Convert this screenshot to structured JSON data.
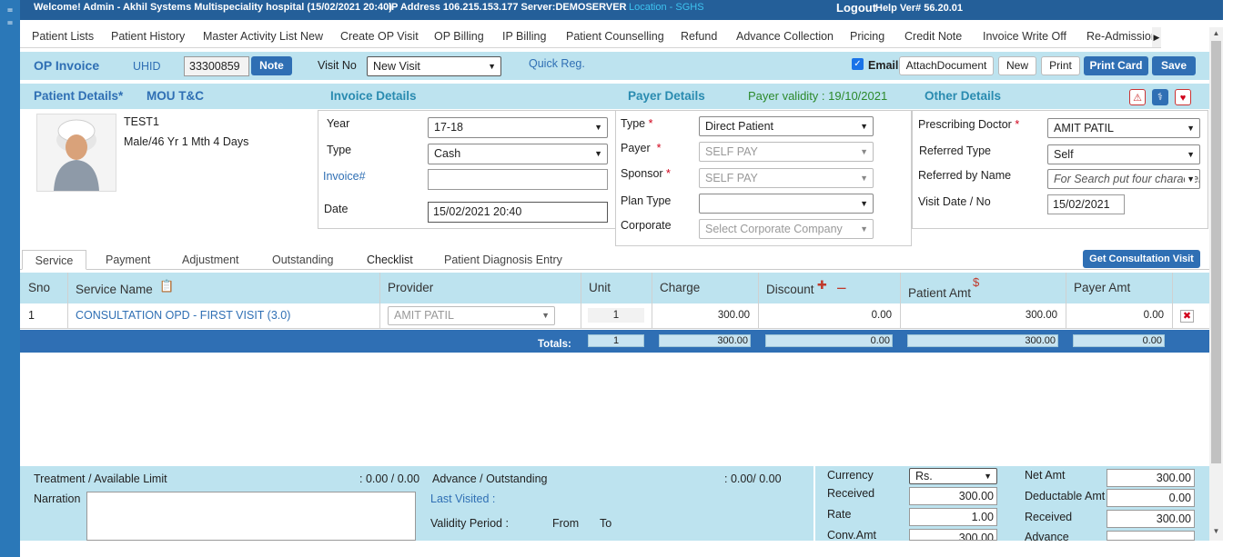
{
  "topbar": {
    "welcome": "Welcome! Admin - Akhil Systems Multispeciality hospital (15/02/2021 20:40)",
    "ip": "IP Address 106.215.153.177 Server:DEMOSERVER",
    "location": "Location - SGHS",
    "logout": "Logout",
    "help": "Help Ver# 56.20.01"
  },
  "menu": [
    "Patient Lists",
    "Patient History",
    "Master Activity List New",
    "Create OP Visit",
    "OP Billing",
    "IP Billing",
    "Patient Counselling",
    "Refund",
    "Advance Collection",
    "Pricing",
    "Credit Note",
    "Invoice Write Off",
    "Re-Admission"
  ],
  "toolbar": {
    "title": "OP Invoice",
    "uhid_label": "UHID",
    "uhid_value": "33300859",
    "note": "Note",
    "visit_no_label": "Visit No",
    "visit_no_value": "New Visit",
    "quick_reg": "Quick Reg.",
    "email_label": "Email",
    "attach": "AttachDocument",
    "new": "New",
    "print": "Print",
    "print_card": "Print Card",
    "save": "Save"
  },
  "sections": {
    "patient_details": "Patient Details*",
    "mou": "MOU T&C",
    "invoice_details": "Invoice Details",
    "payer_details": "Payer Details",
    "payer_validity": "Payer validity : 19/10/2021",
    "other_details": "Other Details"
  },
  "patient": {
    "name": "TEST1",
    "info": "Male/46 Yr 1 Mth 4 Days"
  },
  "invoice": {
    "year_label": "Year",
    "year_value": "17-18",
    "type_label": "Type",
    "type_value": "Cash",
    "invoice_label": "Invoice#",
    "invoice_value": "",
    "date_label": "Date",
    "date_value": "15/02/2021 20:40"
  },
  "payer": {
    "type_label": "Type",
    "type_value": "Direct Patient",
    "payer_label": "Payer",
    "payer_value": "SELF PAY",
    "sponsor_label": "Sponsor",
    "sponsor_value": "SELF PAY",
    "plan_label": "Plan Type",
    "plan_value": "",
    "corporate_label": "Corporate",
    "corporate_value": "Select Corporate Company"
  },
  "other": {
    "doctor_label": "Prescribing Doctor",
    "doctor_value": "AMIT PATIL",
    "ref_type_label": "Referred Type",
    "ref_type_value": "Self",
    "ref_name_label": "Referred by Name",
    "ref_name_placeholder": "For Search put four characters",
    "visit_label": "Visit Date / No",
    "visit_value": "15/02/2021"
  },
  "tabs": [
    "Service",
    "Payment",
    "Adjustment",
    "Outstanding",
    "Checklist",
    "Patient Diagnosis Entry"
  ],
  "get_consult": "Get Consultation Visit",
  "table": {
    "headers": {
      "sno": "Sno",
      "service": "Service Name",
      "provider": "Provider",
      "unit": "Unit",
      "charge": "Charge",
      "discount": "Discount",
      "patient_amt": "Patient Amt",
      "payer_amt": "Payer Amt"
    },
    "rows": [
      {
        "sno": "1",
        "service": "CONSULTATION OPD - FIRST VISIT (3.0)",
        "provider": "AMIT PATIL",
        "unit": "1",
        "charge": "300.00",
        "discount": "0.00",
        "patient_amt": "300.00",
        "payer_amt": "0.00"
      }
    ],
    "totals": {
      "label": "Totals:",
      "unit": "1",
      "charge": "300.00",
      "discount": "0.00",
      "patient_amt": "300.00",
      "payer_amt": "0.00"
    }
  },
  "footer": {
    "treatment_label": "Treatment / Available Limit",
    "treatment_value": ": 0.00 / 0.00",
    "advance_label": "Advance / Outstanding",
    "advance_value": ": 0.00/ 0.00",
    "narration_label": "Narration",
    "last_visited": "Last Visited :",
    "validity_label": "Validity Period :",
    "from": "From",
    "to": "To",
    "currency_label": "Currency",
    "currency_value": "Rs.",
    "received_label": "Received",
    "received_value": "300.00",
    "rate_label": "Rate",
    "rate_value": "1.00",
    "conv_label": "Conv.Amt",
    "conv_value": "300.00",
    "net_label": "Net Amt",
    "net_value": "300.00",
    "deductable_label": "Deductable Amt",
    "deductable_value": "0.00",
    "received2_label": "Received",
    "received2_value": "300.00",
    "advance2_label": "Advance",
    "advance2_value": ""
  }
}
